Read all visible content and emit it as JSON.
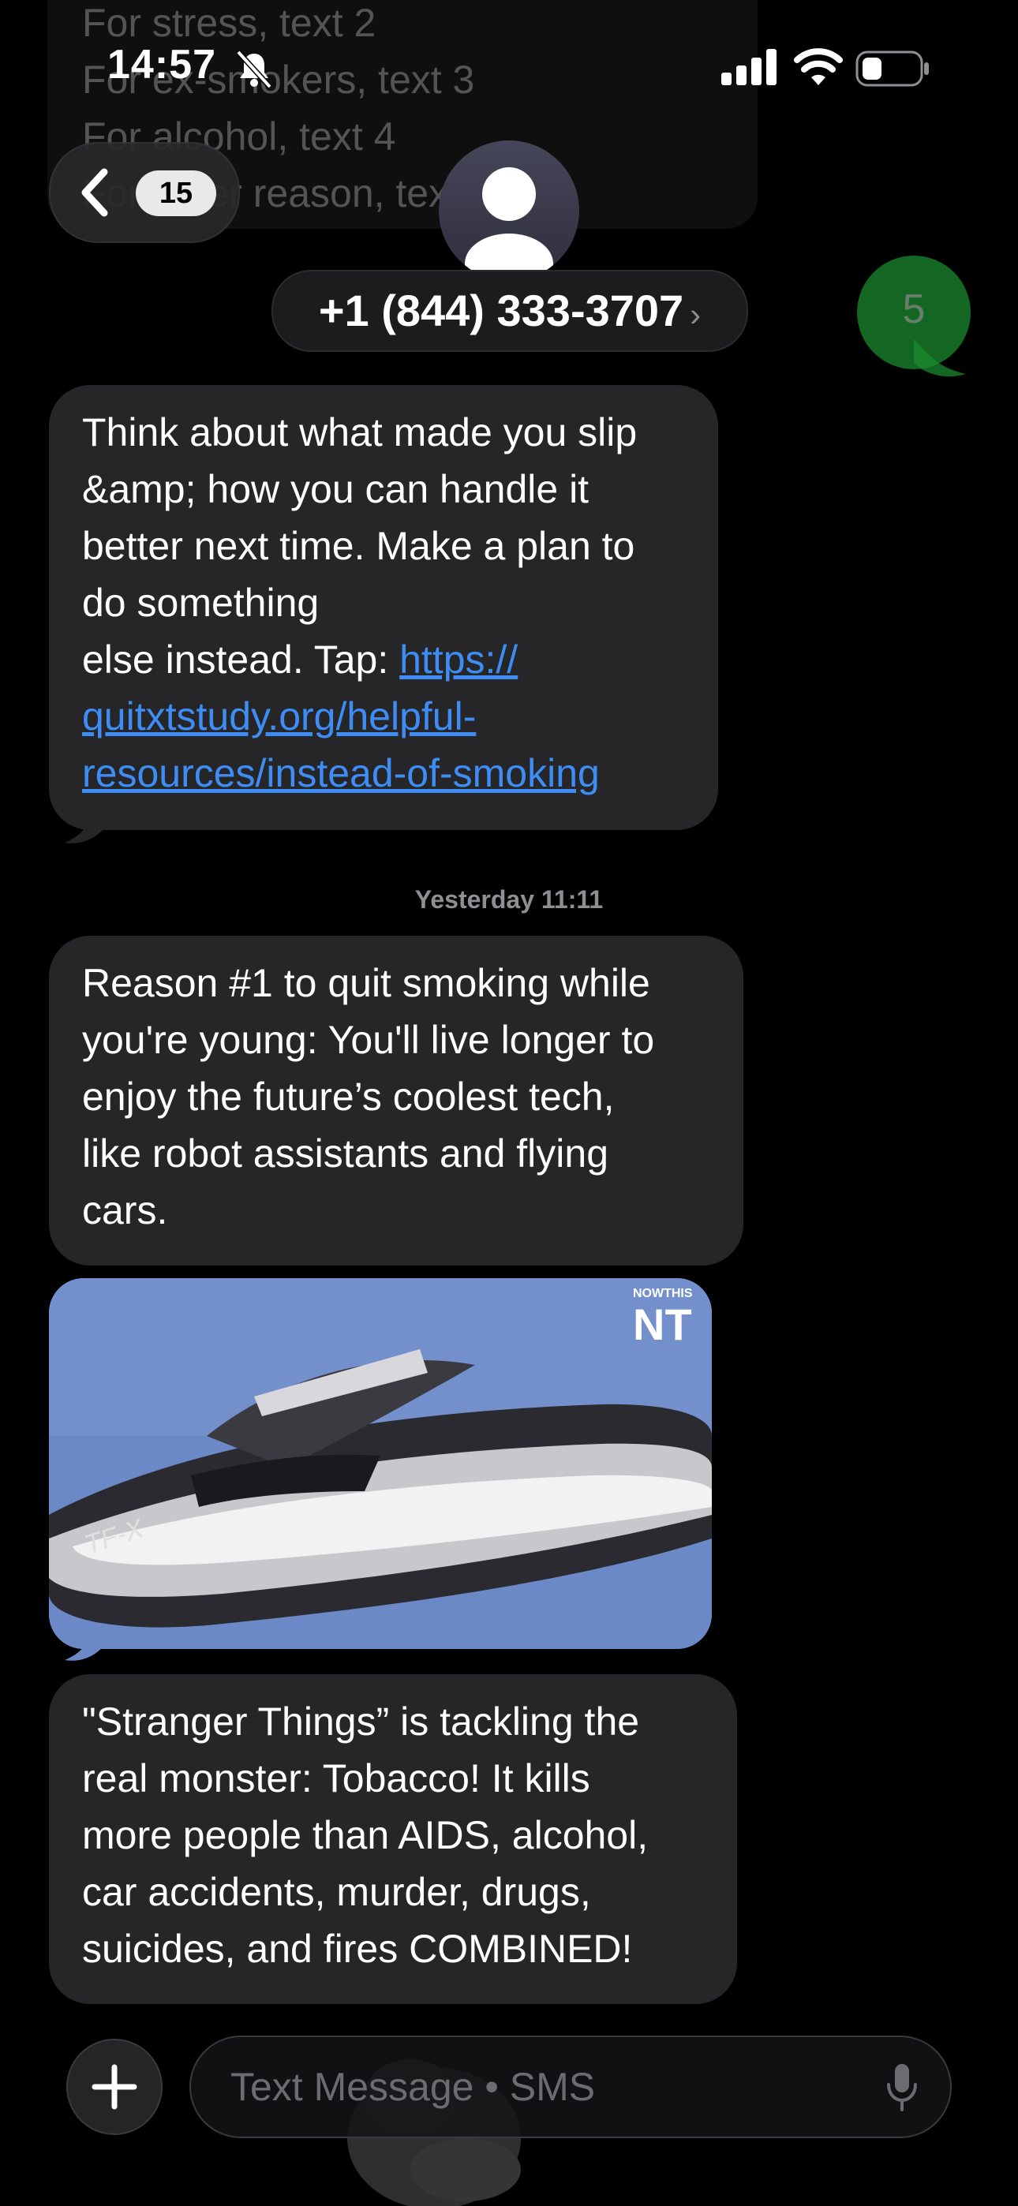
{
  "status_bar": {
    "time": "14:57"
  },
  "faded_message": {
    "lines": [
      "For stress, text 2",
      "For ex-smokers, text 3",
      "For alcohol, text 4",
      "For other reason, text 5"
    ]
  },
  "header": {
    "back_badge": "15",
    "contact_name": "+1 (844) 333-3707",
    "contact_chevron": "›"
  },
  "sent_message": {
    "text": "5"
  },
  "messages": [
    {
      "text": "Think about what made you slip\n&amp; how you can handle it\nbetter next time. Make a plan to\ndo something\nelse instead. Tap: ",
      "link_text": "https://\nquitxtstudy.org/helpful-\nresources/instead-of-smoking"
    },
    {
      "text": "Reason #1 to quit smoking while\nyou're young: You'll live longer to\nenjoy the future’s coolest tech,\nlike robot assistants and flying\ncars."
    },
    {
      "text": "\"Stranger Things” is tackling the\nreal monster: Tobacco! It kills\nmore people than AIDS, alcohol,\ncar accidents, murder, drugs,\nsuicides, and fires COMBINED!"
    }
  ],
  "timestamp": "Yesterday 11:11",
  "image": {
    "watermark_small": "NOWTHIS",
    "watermark_large": "NT",
    "vehicle_label": "TF-X"
  },
  "composer": {
    "placeholder": "Text Message • SMS"
  },
  "colors": {
    "link": "#3d8df5",
    "incoming_bubble": "#262628",
    "sent_bubble": "#1b8a2e"
  }
}
